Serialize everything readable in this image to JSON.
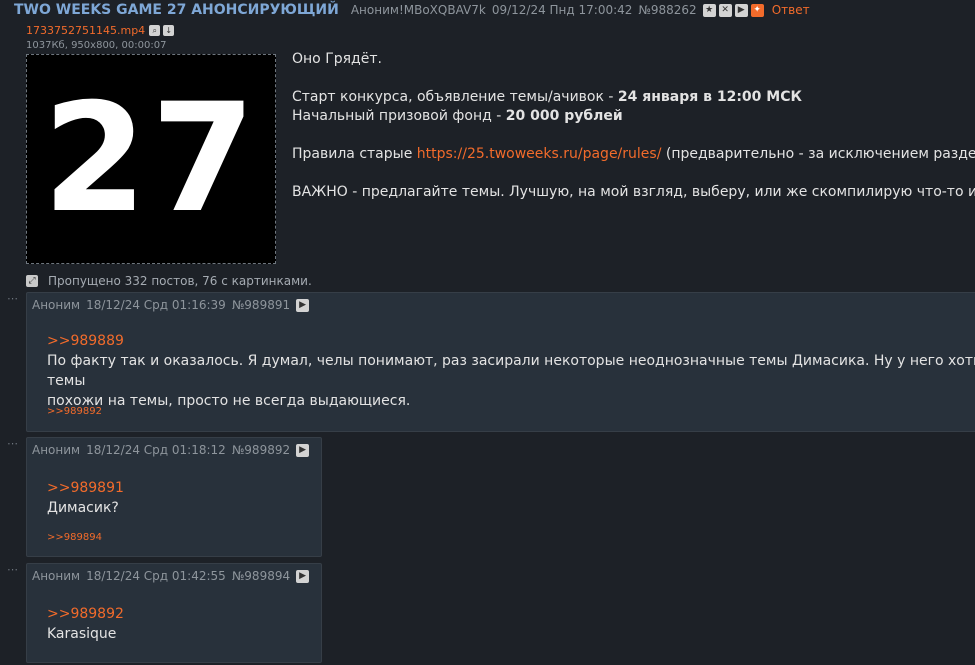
{
  "op": {
    "title": "TWO WEEKS GAME 27 АНОНСИРУЮЩИЙ",
    "author": "Аноним!MBoXQBAV7k",
    "date": "09/12/24 Пнд 17:00:42",
    "num": "№988262",
    "reply_label": "Ответ",
    "file_name": "1733752751145.mp4",
    "file_info": "1037Кб, 950x800, 00:00:07",
    "thumb_text": "27",
    "lines": {
      "l1": "Оно Грядёт.",
      "l2a": "Старт конкурса, объявление темы/ачивок - ",
      "l2b": "24 января в 12:00 МСК",
      "l3a": "Начальный призовой фонд - ",
      "l3b": "20 000 рублей",
      "l4a": "Правила старые ",
      "l4link": "https://25.twoweeks.ru/page/rules/",
      "l4b": " (предварительно - за исключением раздела",
      "l5": "ВАЖНО - предлагайте темы. Лучшую, на мой взгляд, выберу, или же скомпилирую что-то из того"
    }
  },
  "omitted": "Пропущено 332 постов, 76 с картинками.",
  "posts": [
    {
      "author": "Аноним",
      "date": "18/12/24 Срд 01:16:39",
      "num": "№989891",
      "quote": ">>989889",
      "text1": "По факту так и оказалось. Я думал, челы понимают, раз засирали некоторые неоднозначные темы Димасика. Ну у него хоть темы",
      "text2": "похожи на темы, просто не всегда выдающиеся.",
      "backref": ">>989892"
    },
    {
      "author": "Аноним",
      "date": "18/12/24 Срд 01:18:12",
      "num": "№989892",
      "quote": ">>989891",
      "text1": "Димасик?",
      "backref": ">>989894"
    },
    {
      "author": "Аноним",
      "date": "18/12/24 Срд 01:42:55",
      "num": "№989894",
      "quote": ">>989892",
      "text1": "Karasique"
    }
  ],
  "icons": {
    "star": "★",
    "close": "✕",
    "play": "▶",
    "pin": "✦",
    "search": "⌕",
    "download": "↓",
    "expand": "⤢",
    "dots": "⋯"
  },
  "colors": {
    "background": "#1d2127",
    "post_bg": "#28313b",
    "accent": "#f26b2b",
    "title": "#7ea7d6"
  }
}
